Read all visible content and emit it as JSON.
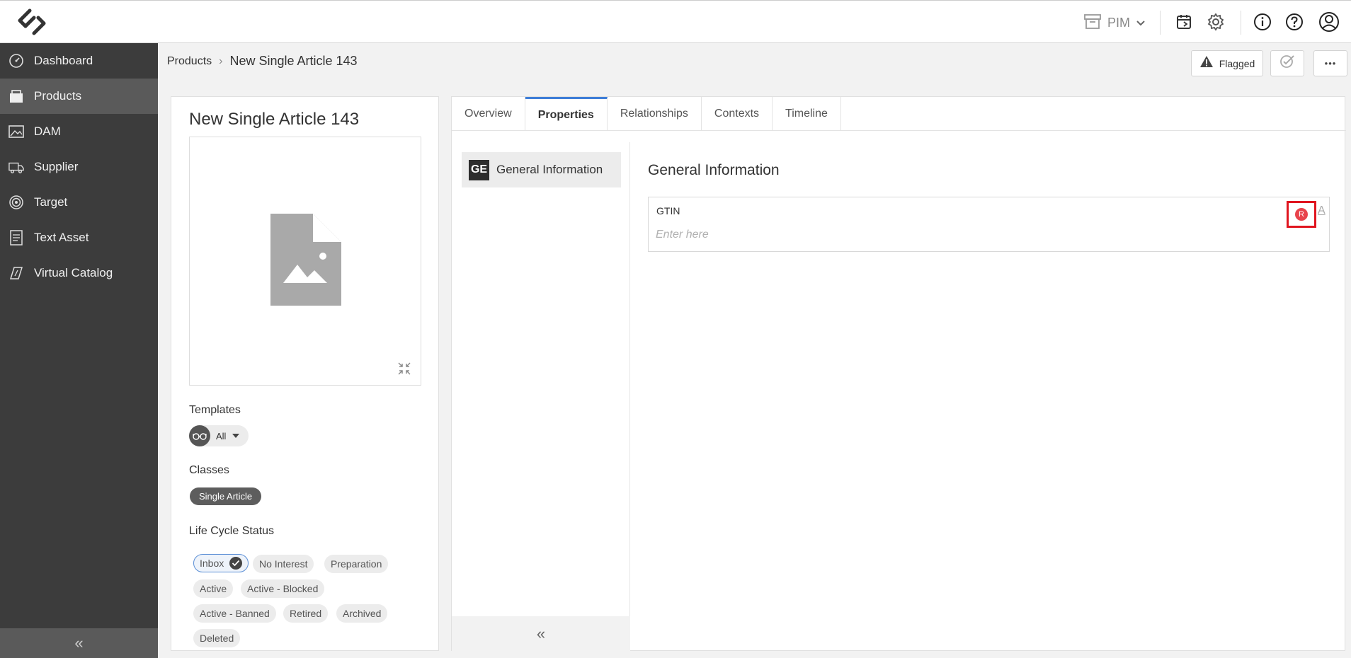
{
  "topbar": {
    "app_switcher": "PIM",
    "icons": [
      "logo-icon",
      "archive-icon",
      "chevron-down-icon",
      "flow-icon",
      "gear-icon",
      "info-icon",
      "help-icon",
      "user-icon"
    ]
  },
  "sidebar": {
    "items": [
      {
        "label": "Dashboard",
        "icon": "dashboard-icon"
      },
      {
        "label": "Products",
        "icon": "products-icon",
        "active": true
      },
      {
        "label": "DAM",
        "icon": "image-icon"
      },
      {
        "label": "Supplier",
        "icon": "truck-icon"
      },
      {
        "label": "Target",
        "icon": "target-icon"
      },
      {
        "label": "Text Asset",
        "icon": "document-icon"
      },
      {
        "label": "Virtual Catalog",
        "icon": "catalog-icon"
      }
    ],
    "collapse_glyph": "«"
  },
  "breadcrumb": {
    "parent": "Products",
    "separator": "›",
    "current": "New Single Article 143"
  },
  "header_actions": {
    "flagged_label": "Flagged",
    "more_glyph": "•••"
  },
  "product": {
    "title": "New Single Article 143",
    "templates_label": "Templates",
    "templates_value": "All",
    "classes_label": "Classes",
    "class_chip": "Single Article",
    "lifecycle_label": "Life Cycle Status",
    "lifecycle": [
      "Inbox",
      "No Interest",
      "Preparation",
      "Active",
      "Active - Blocked",
      "Active - Banned",
      "Retired",
      "Archived",
      "Deleted"
    ],
    "lifecycle_selected": "Inbox"
  },
  "tabs": [
    "Overview",
    "Properties",
    "Relationships",
    "Contexts",
    "Timeline"
  ],
  "active_tab": "Properties",
  "groups": {
    "item_badge": "GE",
    "item_label": "General Information",
    "collapse_glyph": "«"
  },
  "content": {
    "title": "General Information",
    "field_label": "GTIN",
    "field_placeholder": "Enter here",
    "required_marker": "R",
    "lang_marker": "A"
  },
  "colors": {
    "sidebar_bg": "#3c3c3c",
    "active_tab_accent": "#3f7ed8",
    "highlight_box": "#e0151f",
    "required_dot": "#e8434b"
  }
}
